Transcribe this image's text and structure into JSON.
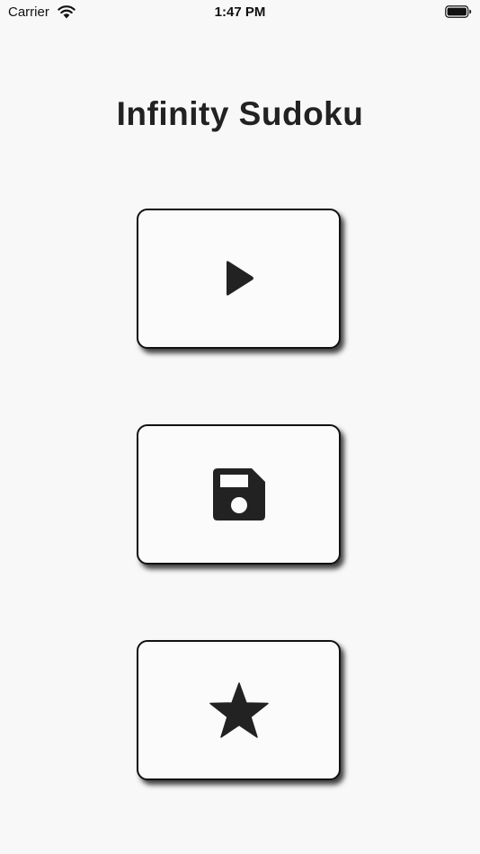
{
  "status_bar": {
    "carrier": "Carrier",
    "time": "1:47 PM",
    "wifi_icon": "wifi-icon",
    "battery_icon": "battery-full-icon"
  },
  "app": {
    "title": "Infinity Sudoku"
  },
  "menu": {
    "buttons": [
      {
        "icon": "play-icon",
        "action": "play"
      },
      {
        "icon": "save-icon",
        "action": "load-saved-game"
      },
      {
        "icon": "star-icon",
        "action": "favorites"
      }
    ]
  },
  "colors": {
    "background": "#f8f8f8",
    "button_fill": "#fbfbfb",
    "icon": "#222222",
    "border": "#111111"
  }
}
